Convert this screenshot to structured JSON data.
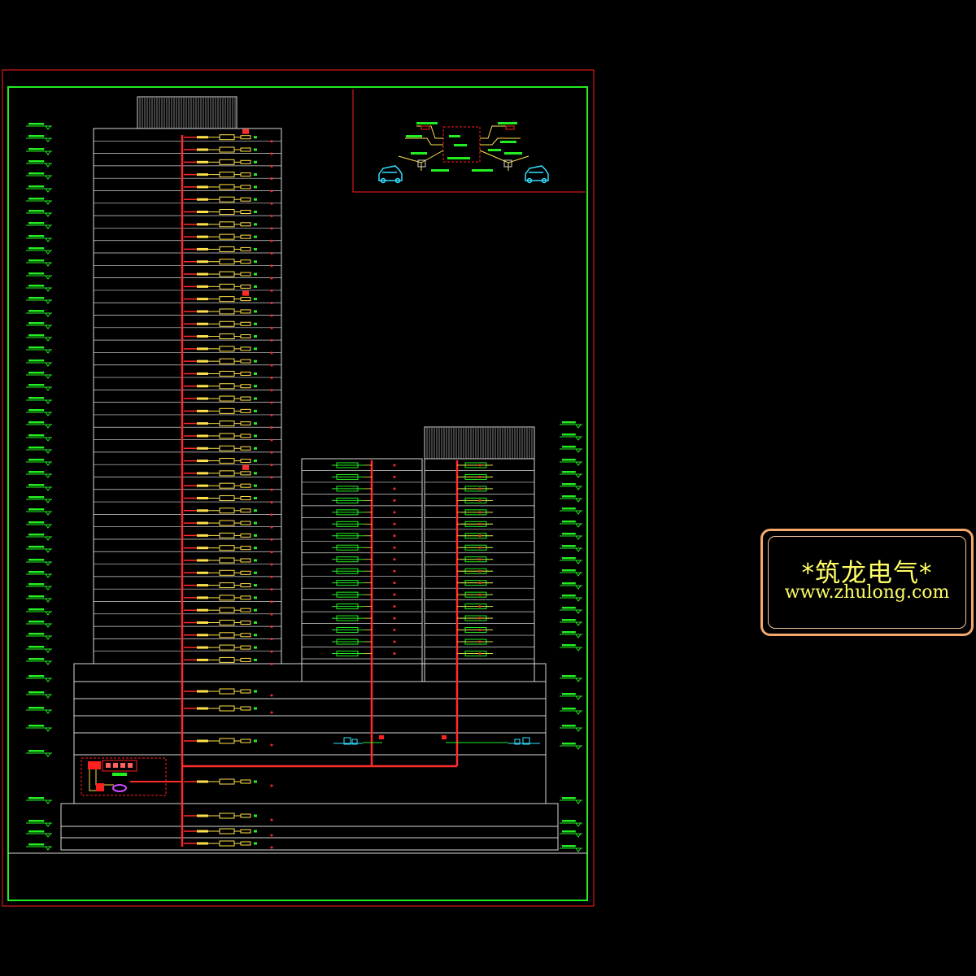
{
  "watermark": {
    "title": "*筑龙电气*",
    "url": "www.zhulong.com"
  },
  "colors": {
    "background": "#000000",
    "outer_frame": "#ff2020",
    "inner_frame": "#22ee22",
    "building_lines": "#d8d8d8",
    "riser": "#ff2b2b",
    "device": "#ffe14d",
    "secondary": "#22ee22",
    "vehicle": "#33e0ff",
    "watermark_text": "#ffff66",
    "watermark_border": "#f6a86b"
  },
  "drawing": {
    "tower_a_floor_count": 43,
    "tower_b_floor_count": 17,
    "tower_c_floor_count": 17,
    "podium_floor_count": 6,
    "basement_floor_count": 4
  }
}
